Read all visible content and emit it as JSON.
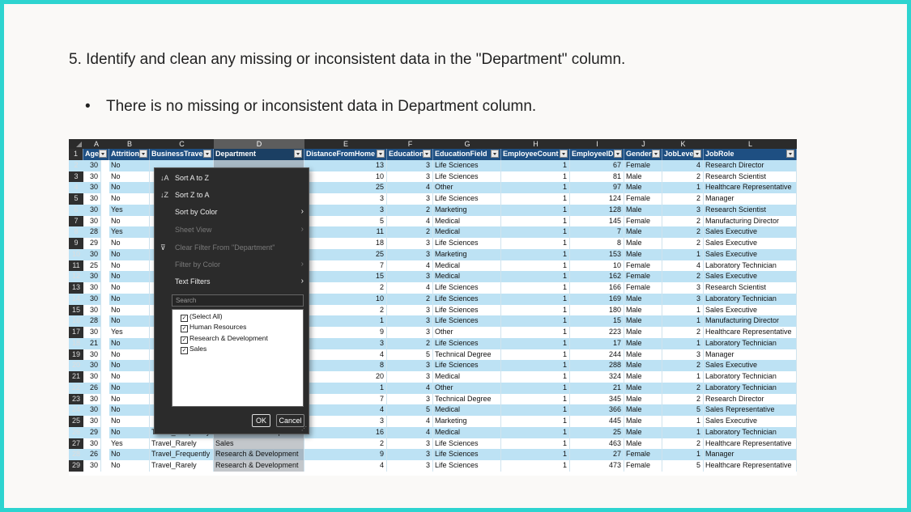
{
  "slide": {
    "task": "5. Identify and clean any missing or inconsistent data in the \"Department\" column.",
    "bullet": "There is no missing or inconsistent data in Department column."
  },
  "sheet": {
    "column_letters": [
      "A",
      "B",
      "C",
      "D",
      "E",
      "F",
      "G",
      "H",
      "I",
      "J",
      "K",
      "L"
    ],
    "headers": [
      "Age",
      "Attrition",
      "BusinessTravel",
      "Department",
      "DistanceFromHome",
      "Education",
      "EducationField",
      "EmployeeCount",
      "EmployeeID",
      "Gender",
      "JobLevel",
      "JobRole"
    ],
    "header_row_number": "1",
    "rows": [
      {
        "n": "2",
        "age": "30",
        "att": "No",
        "bt": "",
        "dept": "",
        "dist": "13",
        "edu": "3",
        "field": "Life Sciences",
        "count": "1",
        "id": "67",
        "gender": "Female",
        "lvl": "4",
        "role": "Research Director"
      },
      {
        "n": "3",
        "age": "30",
        "att": "No",
        "bt": "",
        "dept": "",
        "dist": "10",
        "edu": "3",
        "field": "Life Sciences",
        "count": "1",
        "id": "81",
        "gender": "Male",
        "lvl": "2",
        "role": "Research Scientist"
      },
      {
        "n": "4",
        "age": "30",
        "att": "No",
        "bt": "",
        "dept": "",
        "dist": "25",
        "edu": "4",
        "field": "Other",
        "count": "1",
        "id": "97",
        "gender": "Male",
        "lvl": "1",
        "role": "Healthcare Representative"
      },
      {
        "n": "5",
        "age": "30",
        "att": "No",
        "bt": "",
        "dept": "",
        "dist": "3",
        "edu": "3",
        "field": "Life Sciences",
        "count": "1",
        "id": "124",
        "gender": "Female",
        "lvl": "2",
        "role": "Manager"
      },
      {
        "n": "6",
        "age": "30",
        "att": "Yes",
        "bt": "",
        "dept": "",
        "dist": "3",
        "edu": "2",
        "field": "Marketing",
        "count": "1",
        "id": "128",
        "gender": "Male",
        "lvl": "3",
        "role": "Research Scientist"
      },
      {
        "n": "7",
        "age": "30",
        "att": "No",
        "bt": "",
        "dept": "",
        "dist": "5",
        "edu": "4",
        "field": "Medical",
        "count": "1",
        "id": "145",
        "gender": "Female",
        "lvl": "2",
        "role": "Manufacturing Director"
      },
      {
        "n": "8",
        "age": "28",
        "att": "Yes",
        "bt": "",
        "dept": "",
        "dist": "11",
        "edu": "2",
        "field": "Medical",
        "count": "1",
        "id": "7",
        "gender": "Male",
        "lvl": "2",
        "role": "Sales Executive"
      },
      {
        "n": "9",
        "age": "29",
        "att": "No",
        "bt": "",
        "dept": "",
        "dist": "18",
        "edu": "3",
        "field": "Life Sciences",
        "count": "1",
        "id": "8",
        "gender": "Male",
        "lvl": "2",
        "role": "Sales Executive"
      },
      {
        "n": "10",
        "age": "30",
        "att": "No",
        "bt": "",
        "dept": "",
        "dist": "25",
        "edu": "3",
        "field": "Marketing",
        "count": "1",
        "id": "153",
        "gender": "Male",
        "lvl": "1",
        "role": "Sales Executive"
      },
      {
        "n": "11",
        "age": "25",
        "att": "No",
        "bt": "",
        "dept": "",
        "dist": "7",
        "edu": "4",
        "field": "Medical",
        "count": "1",
        "id": "10",
        "gender": "Female",
        "lvl": "4",
        "role": "Laboratory Technician"
      },
      {
        "n": "12",
        "age": "30",
        "att": "No",
        "bt": "",
        "dept": "",
        "dist": "15",
        "edu": "3",
        "field": "Medical",
        "count": "1",
        "id": "162",
        "gender": "Female",
        "lvl": "2",
        "role": "Sales Executive"
      },
      {
        "n": "13",
        "age": "30",
        "att": "No",
        "bt": "",
        "dept": "",
        "dist": "2",
        "edu": "4",
        "field": "Life Sciences",
        "count": "1",
        "id": "166",
        "gender": "Female",
        "lvl": "3",
        "role": "Research Scientist"
      },
      {
        "n": "14",
        "age": "30",
        "att": "No",
        "bt": "",
        "dept": "",
        "dist": "10",
        "edu": "2",
        "field": "Life Sciences",
        "count": "1",
        "id": "169",
        "gender": "Male",
        "lvl": "3",
        "role": "Laboratory Technician"
      },
      {
        "n": "15",
        "age": "30",
        "att": "No",
        "bt": "",
        "dept": "",
        "dist": "2",
        "edu": "3",
        "field": "Life Sciences",
        "count": "1",
        "id": "180",
        "gender": "Male",
        "lvl": "1",
        "role": "Sales Executive"
      },
      {
        "n": "16",
        "age": "28",
        "att": "No",
        "bt": "",
        "dept": "",
        "dist": "1",
        "edu": "3",
        "field": "Life Sciences",
        "count": "1",
        "id": "15",
        "gender": "Male",
        "lvl": "1",
        "role": "Manufacturing Director"
      },
      {
        "n": "17",
        "age": "30",
        "att": "Yes",
        "bt": "",
        "dept": "",
        "dist": "9",
        "edu": "3",
        "field": "Other",
        "count": "1",
        "id": "223",
        "gender": "Male",
        "lvl": "2",
        "role": "Healthcare Representative"
      },
      {
        "n": "18",
        "age": "21",
        "att": "No",
        "bt": "",
        "dept": "",
        "dist": "3",
        "edu": "2",
        "field": "Life Sciences",
        "count": "1",
        "id": "17",
        "gender": "Male",
        "lvl": "1",
        "role": "Laboratory Technician"
      },
      {
        "n": "19",
        "age": "30",
        "att": "No",
        "bt": "",
        "dept": "",
        "dist": "4",
        "edu": "5",
        "field": "Technical Degree",
        "count": "1",
        "id": "244",
        "gender": "Male",
        "lvl": "3",
        "role": "Manager"
      },
      {
        "n": "20",
        "age": "30",
        "att": "No",
        "bt": "",
        "dept": "",
        "dist": "8",
        "edu": "3",
        "field": "Life Sciences",
        "count": "1",
        "id": "288",
        "gender": "Male",
        "lvl": "2",
        "role": "Sales Executive"
      },
      {
        "n": "21",
        "age": "30",
        "att": "No",
        "bt": "",
        "dept": "",
        "dist": "20",
        "edu": "3",
        "field": "Medical",
        "count": "1",
        "id": "324",
        "gender": "Male",
        "lvl": "1",
        "role": "Laboratory Technician"
      },
      {
        "n": "22",
        "age": "26",
        "att": "No",
        "bt": "",
        "dept": "",
        "dist": "1",
        "edu": "4",
        "field": "Other",
        "count": "1",
        "id": "21",
        "gender": "Male",
        "lvl": "2",
        "role": "Laboratory Technician"
      },
      {
        "n": "23",
        "age": "30",
        "att": "No",
        "bt": "",
        "dept": "",
        "dist": "7",
        "edu": "3",
        "field": "Technical Degree",
        "count": "1",
        "id": "345",
        "gender": "Male",
        "lvl": "2",
        "role": "Research Director"
      },
      {
        "n": "24",
        "age": "30",
        "att": "No",
        "bt": "",
        "dept": "",
        "dist": "4",
        "edu": "5",
        "field": "Medical",
        "count": "1",
        "id": "366",
        "gender": "Male",
        "lvl": "5",
        "role": "Sales Representative"
      },
      {
        "n": "25",
        "age": "30",
        "att": "No",
        "bt": "",
        "dept": "",
        "dist": "3",
        "edu": "4",
        "field": "Marketing",
        "count": "1",
        "id": "445",
        "gender": "Male",
        "lvl": "1",
        "role": "Sales Executive"
      },
      {
        "n": "26",
        "age": "29",
        "att": "No",
        "bt": "Travel_Frequently",
        "dept": "Research & Development",
        "dist": "16",
        "edu": "4",
        "field": "Medical",
        "count": "1",
        "id": "25",
        "gender": "Male",
        "lvl": "1",
        "role": "Laboratory Technician"
      },
      {
        "n": "27",
        "age": "30",
        "att": "Yes",
        "bt": "Travel_Rarely",
        "dept": "Sales",
        "dist": "2",
        "edu": "3",
        "field": "Life Sciences",
        "count": "1",
        "id": "463",
        "gender": "Male",
        "lvl": "2",
        "role": "Healthcare Representative"
      },
      {
        "n": "28",
        "age": "26",
        "att": "No",
        "bt": "Travel_Frequently",
        "dept": "Research & Development",
        "dist": "9",
        "edu": "3",
        "field": "Life Sciences",
        "count": "1",
        "id": "27",
        "gender": "Female",
        "lvl": "1",
        "role": "Manager"
      },
      {
        "n": "29",
        "age": "30",
        "att": "No",
        "bt": "Travel_Rarely",
        "dept": "Research & Development",
        "dist": "4",
        "edu": "3",
        "field": "Life Sciences",
        "count": "1",
        "id": "473",
        "gender": "Female",
        "lvl": "5",
        "role": "Healthcare Representative"
      }
    ]
  },
  "filter_menu": {
    "sort_az": "Sort A to Z",
    "sort_za": "Sort Z to A",
    "sort_by_color": "Sort by Color",
    "sheet_view": "Sheet View",
    "clear_filter": "Clear Filter From \"Department\"",
    "filter_by_color": "Filter by Color",
    "text_filters": "Text Filters",
    "search_placeholder": "Search",
    "values": [
      {
        "label": "(Select All)",
        "checked": true
      },
      {
        "label": "Human Resources",
        "checked": true
      },
      {
        "label": "Research & Development",
        "checked": true
      },
      {
        "label": "Sales",
        "checked": true
      }
    ],
    "ok": "OK",
    "cancel": "Cancel"
  },
  "colors": {
    "accent": "#2dd4d0",
    "header_fill": "#1e4f82",
    "band_fill": "#bde2f4"
  }
}
